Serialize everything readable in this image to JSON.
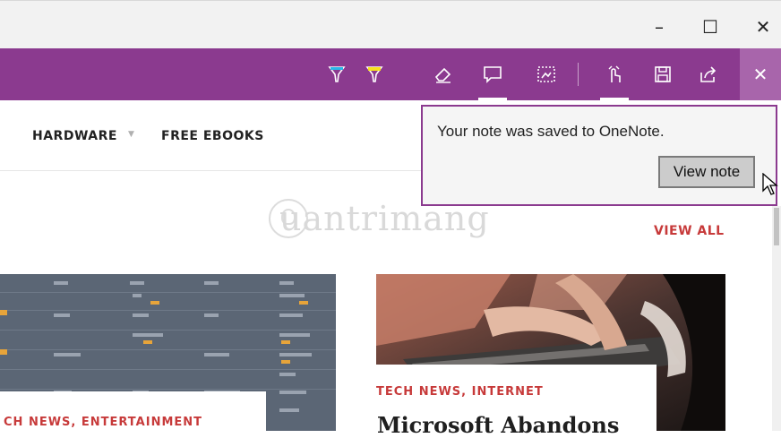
{
  "window": {
    "minimize_glyph": "–",
    "maximize_glyph": "☐",
    "close_glyph": "✕"
  },
  "toolbar": {
    "color": "#8b3a8f",
    "tools": [
      {
        "name": "pen-icon"
      },
      {
        "name": "highlighter-icon"
      },
      {
        "name": "eraser-icon"
      },
      {
        "name": "comment-icon"
      },
      {
        "name": "clip-icon"
      },
      {
        "name": "touch-write-icon"
      },
      {
        "name": "save-icon"
      },
      {
        "name": "share-icon"
      }
    ],
    "exit_glyph": "✕"
  },
  "nav": {
    "items": [
      "HARDWARE",
      "FREE EBOOKS"
    ],
    "caret_glyph": "▼"
  },
  "popup": {
    "message": "Your note was saved to OneNote.",
    "button_label": "View note"
  },
  "watermark": {
    "text": "uantrimang"
  },
  "section": {
    "view_all": "VIEW ALL"
  },
  "cards": [
    {
      "category": "CH NEWS, ENTERTAINMENT"
    },
    {
      "category": "TECH NEWS, INTERNET",
      "title": "Microsoft Abandons"
    }
  ],
  "colors": {
    "accent": "#8b3a8f",
    "link_red": "#c73a3a"
  }
}
